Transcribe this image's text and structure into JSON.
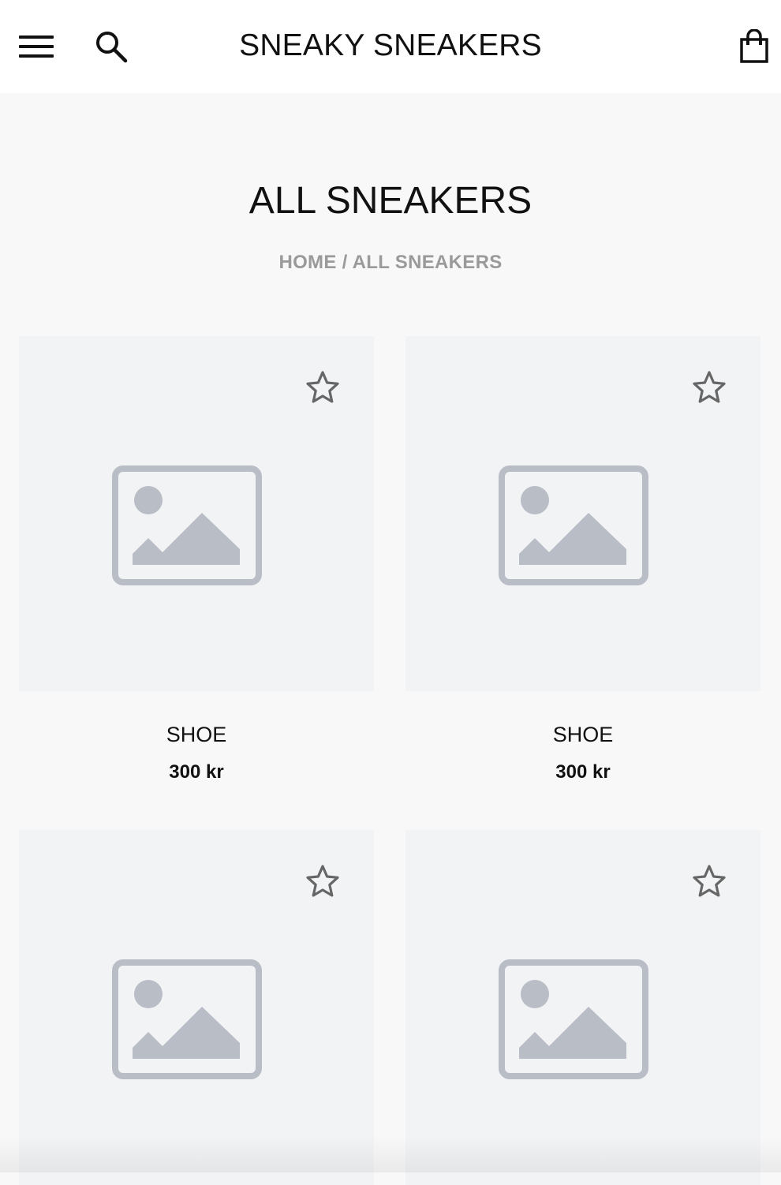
{
  "header": {
    "brand": "SNEAKY SNEAKERS",
    "menu_icon": "hamburger-menu-icon",
    "search_icon": "search-icon",
    "cart_icon": "shopping-bag-icon"
  },
  "page": {
    "title": "ALL SNEAKERS",
    "breadcrumb": {
      "home": "HOME",
      "separator": " / ",
      "current": "ALL SNEAKERS"
    }
  },
  "products": [
    {
      "name": "SHOE",
      "price": "300 kr",
      "image": "image-placeholder-icon",
      "favorite_icon": "star-outline-icon"
    },
    {
      "name": "SHOE",
      "price": "300 kr",
      "image": "image-placeholder-icon",
      "favorite_icon": "star-outline-icon"
    },
    {
      "name": "",
      "price": "",
      "image": "image-placeholder-icon",
      "favorite_icon": "star-outline-icon"
    },
    {
      "name": "",
      "price": "",
      "image": "image-placeholder-icon",
      "favorite_icon": "star-outline-icon"
    }
  ],
  "colors": {
    "header_bg": "#ffffff",
    "page_bg": "#f8f8f8",
    "image_bg": "#f2f3f5",
    "placeholder": "#b9bdc6",
    "breadcrumb": "#9a9a9a",
    "text": "#111111"
  }
}
